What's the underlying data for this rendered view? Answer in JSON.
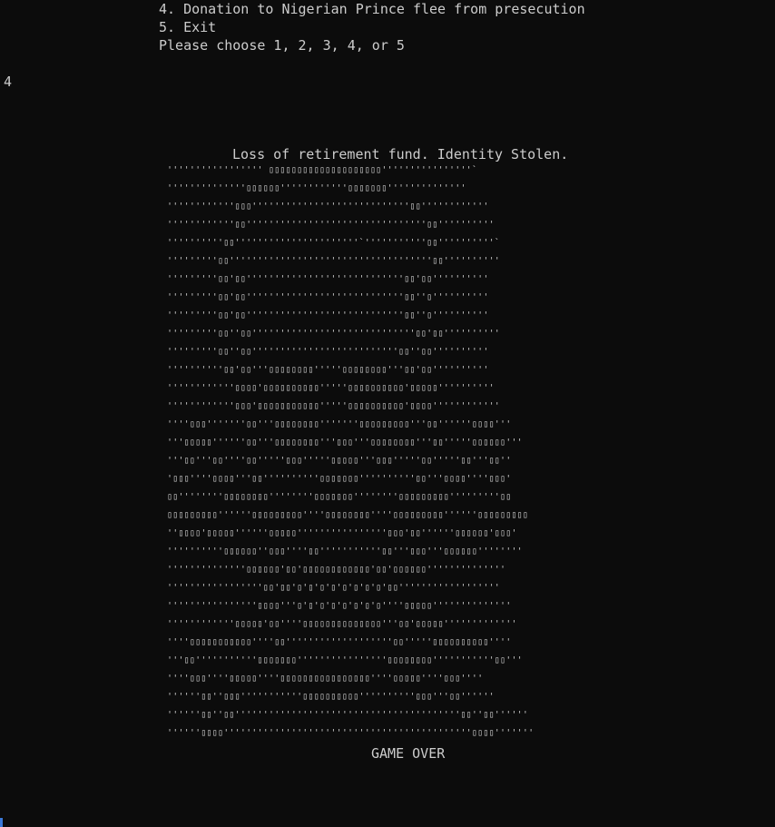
{
  "console": {
    "menu_line_4": "4. Donation to Nigerian Prince flee from presecution",
    "menu_line_5": "5. Exit",
    "prompt": "Please choose 1, 2, 3, 4, or 5",
    "user_input": "4",
    "message": "Loss of retirement fund. Identity Stolen.",
    "game_over": "GAME OVER"
  },
  "ascii_art": [
    "''''''''''''''''' ▯▯▯▯▯▯▯▯▯▯▯▯▯▯▯▯▯▯▯▯''''''''''''''''`",
    "''''''''''''''▯▯▯▯▯▯''''''''''''▯▯▯▯▯▯▯''''''''''''''",
    "''''''''''''▯▯▯''''''''''''''''''''''''''''▯▯''''''''''''",
    "''''''''''''▯▯''''''''''''''''''''''''''''''''▯▯''''''''''",
    "''''''''''▯▯''''''''''''''''''''''`'''''''''''▯▯''''''''''`",
    "'''''''''▯▯''''''''''''''''''''''''''''''''''''▯▯''''''''''",
    "'''''''''▯▯'▯▯''''''''''''''''''''''''''''▯▯'▯▯''''''''''",
    "'''''''''▯▯'▯▯''''''''''''''''''''''''''''▯▯''▯''''''''''",
    "'''''''''▯▯'▯▯''''''''''''''''''''''''''''▯▯''▯''''''''''",
    "'''''''''▯▯''▯▯'''''''''''''''''''''''''''''▯▯'▯▯''''''''''",
    "'''''''''▯▯''▯▯''''''''''''''''''''''''''▯▯''▯▯''''''''''",
    "''''''''''▯▯'▯▯'''▯▯▯▯▯▯▯▯'''''▯▯▯▯▯▯▯▯'''▯▯'▯▯''''''''''",
    "''''''''''''▯▯▯▯'▯▯▯▯▯▯▯▯▯▯'''''▯▯▯▯▯▯▯▯▯▯'▯▯▯▯▯''''''''''",
    "''''''''''''▯▯▯'▯▯▯▯▯▯▯▯▯▯▯'''''▯▯▯▯▯▯▯▯▯▯'▯▯▯▯''''''''''''",
    "''''▯▯▯'''''''▯▯'''▯▯▯▯▯▯▯▯'''''''▯▯▯▯▯▯▯▯▯'''▯▯''''''▯▯▯▯'''",
    "'''▯▯▯▯▯''''''▯▯'''▯▯▯▯▯▯▯▯'''▯▯▯'''▯▯▯▯▯▯▯▯'''▯▯'''''▯▯▯▯▯▯'''",
    "'''▯▯'''▯▯''''▯▯'''''▯▯▯'''''▯▯▯▯▯'''▯▯▯'''''▯▯'''''▯▯'''▯▯''",
    "'▯▯▯''''▯▯▯▯'''▯▯''''''''''▯▯▯▯▯▯▯''''''''''▯▯'''▯▯▯▯''''▯▯▯'",
    "▯▯''''''''▯▯▯▯▯▯▯▯''''''''▯▯▯▯▯▯▯''''''''▯▯▯▯▯▯▯▯▯'''''''''▯▯",
    "▯▯▯▯▯▯▯▯▯''''''▯▯▯▯▯▯▯▯▯''''▯▯▯▯▯▯▯▯''''▯▯▯▯▯▯▯▯▯''''''▯▯▯▯▯▯▯▯▯",
    "''▯▯▯▯'▯▯▯▯▯''''''▯▯▯▯▯''''''''''''''''▯▯▯'▯▯''''''▯▯▯▯▯▯'▯▯▯'",
    "''''''''''▯▯▯▯▯▯''▯▯▯''''▯▯'''''''''''▯▯'''▯▯▯'''▯▯▯▯▯▯''''''''",
    "''''''''''''''▯▯▯▯▯▯'▯▯'▯▯▯▯▯▯▯▯▯▯▯▯'▯▯'▯▯▯▯▯▯''''''''''''''",
    "'''''''''''''''''▯▯'▯▯'▯'▯'▯'▯'▯'▯'▯'▯'▯▯''''''''''''''''''",
    "''''''''''''''''▯▯▯▯'''▯'▯'▯'▯'▯'▯'▯'▯''''▯▯▯▯▯''''''''''''''",
    "''''''''''''▯▯▯▯▯'▯▯''''▯▯▯▯▯▯▯▯▯▯▯▯▯▯'''▯▯'▯▯▯▯▯'''''''''''''",
    "''''▯▯▯▯▯▯▯▯▯▯▯''''▯▯'''''''''''''''''''▯▯'''''▯▯▯▯▯▯▯▯▯▯''''",
    "'''▯▯'''''''''''▯▯▯▯▯▯▯''''''''''''''''▯▯▯▯▯▯▯▯'''''''''''▯▯'''",
    "''''▯▯▯''''▯▯▯▯▯''''▯▯▯▯▯▯▯▯▯▯▯▯▯▯▯▯''''▯▯▯▯▯''''▯▯▯''''",
    "''''''▯▯''▯▯▯'''''''''''▯▯▯▯▯▯▯▯▯▯''''''''''▯▯▯'''▯▯''''''",
    "''''''▯▯''▯▯''''''''''''''''''''''''''''''''''''''''▯▯''▯▯''''''",
    "''''''▯▯▯▯''''''''''''''''''''''''''''''''''''''''''''▯▯▯▯'''''''"
  ]
}
